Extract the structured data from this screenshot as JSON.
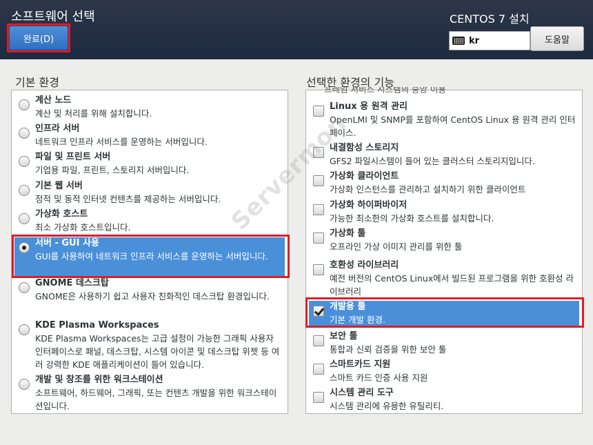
{
  "header": {
    "title": "소프트웨어 선택",
    "done_label": "완료(D)",
    "product": "CENTOS 7 설치",
    "keyboard_layout": "kr",
    "help_label": "도움말"
  },
  "base_env": {
    "label": "기본 환경",
    "items": [
      {
        "name": "계산 노드",
        "desc": "계산 및 처리를 위해 설치합니다.",
        "selected": false
      },
      {
        "name": "인프라 서버",
        "desc": "네트워크 인프라 서비스를 운영하는 서버입니다.",
        "selected": false
      },
      {
        "name": "파일 및 프린트 서버",
        "desc": "기업용 파일, 프린트, 스토리지 서버입니다.",
        "selected": false
      },
      {
        "name": "기본 웹 서버",
        "desc": "정적 및 동적 인터넷 컨텐츠를 제공하는 서버입니다.",
        "selected": false
      },
      {
        "name": "가상화 호스트",
        "desc": "최소 가상화 호스트입니다.",
        "selected": false
      },
      {
        "name": "서버 - GUI 사용",
        "desc": "GUI를 사용하여 네트워크 인프라 서비스를 운영하는 서버입니다.",
        "selected": true
      },
      {
        "name": "GNOME 데스크탑",
        "desc": "GNOME은 사용하기 쉽고 사용자 친화적인 데스크탑 환경입니다.",
        "selected": false
      },
      {
        "name": "KDE Plasma Workspaces",
        "desc": "KDE Plasma Workspaces는 고급 설정이 가능한 그래픽 사용자 인터페이스로 패널, 데스크탑, 시스템 아이콘 및 데스크탑 위젯 등 여러 강력한 KDE 애플리케이션이 들어 있습니다.",
        "selected": false
      },
      {
        "name": "개발 및 창조를 위한 워크스테이션",
        "desc": "소프트웨어, 하드웨어, 그래픽, 또는 컨텐츠 개발을 위한 워크스테이션입니다.",
        "selected": false
      }
    ]
  },
  "addons": {
    "label": "선택한 환경의 기능",
    "partial_line": "프레임 서비스 시스템의 중앙 이용",
    "items": [
      {
        "name": "Linux 용 원격 관리",
        "desc": "OpenLMI 및 SNMP를 포함하여 CentOS Linux 용 원격 관리 인터페이스.",
        "checked": false
      },
      {
        "name": "내결함성 스토리지",
        "desc": "GFS2 파일시스템이 들어 있는 클러스터 스토리지입니다.",
        "checked": false
      },
      {
        "name": "가상화 클라이언트",
        "desc": "가상화 인스턴스를 관리하고 설치하기 위한 클라이언트",
        "checked": false
      },
      {
        "name": "가상화 하이퍼바이저",
        "desc": "가능한 최소한의 가상화 호스트를 설치합니다.",
        "checked": false
      },
      {
        "name": "가상화 툴",
        "desc": "오프라인 가상 이미지 관리를 위한 툴",
        "checked": false
      },
      {
        "name": "호환성 라이브러리",
        "desc": "예전 버전의 CentOS Linux에서 빌드된 프로그램을 위한 호환성 라이브러리",
        "checked": false
      },
      {
        "name": "개발용 툴",
        "desc": "기본 개발 환경.",
        "checked": true
      },
      {
        "name": "보안 툴",
        "desc": "통합과 신뢰 검증을 위한 보안 툴",
        "checked": false
      },
      {
        "name": "스마트카드 지원",
        "desc": "스마트 카드 인증 사용 지원",
        "checked": false
      },
      {
        "name": "시스템 관리 도구",
        "desc": "시스템 관리에 유용한 유틸리티.",
        "checked": false
      }
    ]
  },
  "watermark": "Servermon"
}
